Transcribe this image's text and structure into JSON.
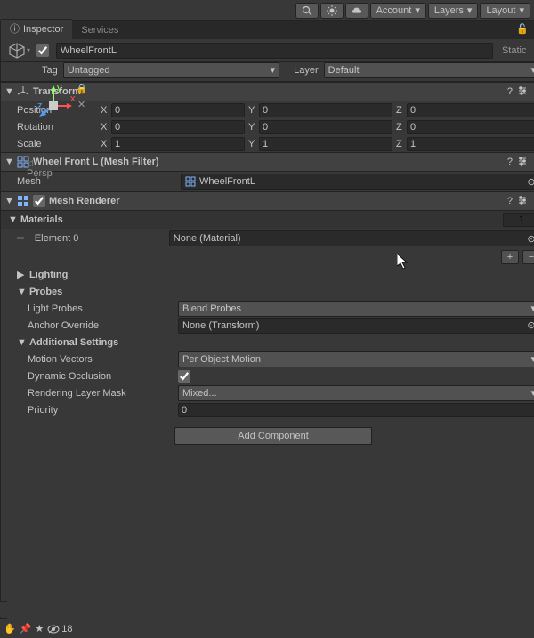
{
  "toolbar": {
    "account": "Account",
    "layers": "Layers",
    "layout": "Layout"
  },
  "tabs": {
    "inspector": "Inspector",
    "services": "Services"
  },
  "gameObject": {
    "name": "WheelFrontL",
    "static": "Static",
    "tagLabel": "Tag",
    "tag": "Untagged",
    "layerLabel": "Layer",
    "layer": "Default"
  },
  "transform": {
    "title": "Transform",
    "position": {
      "label": "Position",
      "x": "0",
      "y": "0",
      "z": "0"
    },
    "rotation": {
      "label": "Rotation",
      "x": "0",
      "y": "0",
      "z": "0"
    },
    "scale": {
      "label": "Scale",
      "x": "1",
      "y": "1",
      "z": "1"
    }
  },
  "meshFilter": {
    "title": "Wheel Front L (Mesh Filter)",
    "meshLabel": "Mesh",
    "mesh": "WheelFrontL"
  },
  "meshRenderer": {
    "title": "Mesh Renderer",
    "materialsLabel": "Materials",
    "materialsCount": "1",
    "element0Label": "Element 0",
    "element0": "None (Material)",
    "lightingLabel": "Lighting",
    "probesLabel": "Probes",
    "lightProbesLabel": "Light Probes",
    "lightProbes": "Blend Probes",
    "anchorLabel": "Anchor Override",
    "anchor": "None (Transform)",
    "additionalLabel": "Additional Settings",
    "motionLabel": "Motion Vectors",
    "motion": "Per Object Motion",
    "dynOccLabel": "Dynamic Occlusion",
    "renderLayerLabel": "Rendering Layer Mask",
    "renderLayer": "Mixed...",
    "priorityLabel": "Priority",
    "priority": "0"
  },
  "addComponent": "Add Component",
  "scene": {
    "persp": "Persp",
    "visCount": "18"
  }
}
